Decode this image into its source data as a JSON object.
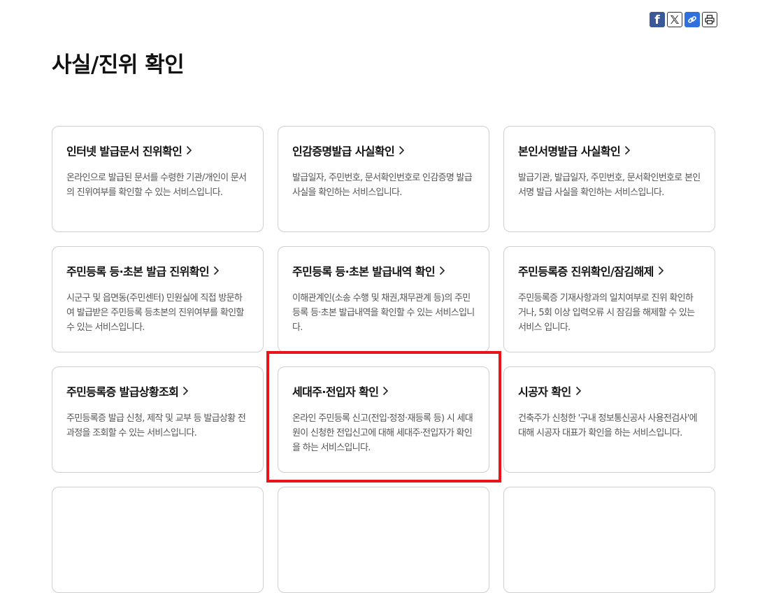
{
  "page": {
    "title": "사실/진위 확인"
  },
  "share": [
    {
      "name": "facebook-icon",
      "glyph": "f"
    },
    {
      "name": "x-icon"
    },
    {
      "name": "link-icon"
    },
    {
      "name": "print-icon"
    }
  ],
  "cards": [
    {
      "title": "인터넷 발급문서 진위확인",
      "desc": "온라인으로 발급된 문서를 수령한 기관/개인이 문서의 진위여부를 확인할 수 있는 서비스입니다."
    },
    {
      "title": "인감증명발급 사실확인",
      "desc": "발급일자, 주민번호, 문서확인번호로 인감증명 발급 사실을 확인하는 서비스입니다."
    },
    {
      "title": "본인서명발급 사실확인",
      "desc": "발급기관, 발급일자, 주민번호, 문서확인번호로 본인서명 발급 사실을 확인하는 서비스입니다."
    },
    {
      "title": "주민등록 등·초본 발급 진위확인",
      "desc": "시군구 및 읍면동(주민센터) 민원실에 직접 방문하여 발급받은 주민등록 등초본의 진위여부를 확인할 수 있는 서비스입니다."
    },
    {
      "title": "주민등록 등·초본 발급내역 확인",
      "desc": "이해관계인(소송 수행 및 채권,채무관계 등)의 주민등록 등·초본 발급내역을 확인할 수 있는 서비스입니다."
    },
    {
      "title": "주민등록증 진위확인/잠김해제",
      "desc": "주민등록증 기재사항과의 일치여부로 진위 확인하거나, 5회 이상 입력오류 시 잠김을 해제할 수 있는 서비스 입니다."
    },
    {
      "title": "주민등록증 발급상황조회",
      "desc": "주민등록증 발급 신청, 제작 및 교부 등 발급상황 전 과정을 조회할 수 있는 서비스입니다."
    },
    {
      "title": "세대주·전입자 확인",
      "desc": "온라인 주민등록 신고(전입·정정·재등록 등) 시 세대원이 신청한 전입신고에 대해 세대주·전입자가 확인을 하는 서비스입니다."
    },
    {
      "title": "시공자 확인",
      "desc": "건축주가 신청한 '구내 정보통신공사 사용전검사'에 대해 시공자 대표가 확인을 하는 서비스입니다."
    }
  ]
}
